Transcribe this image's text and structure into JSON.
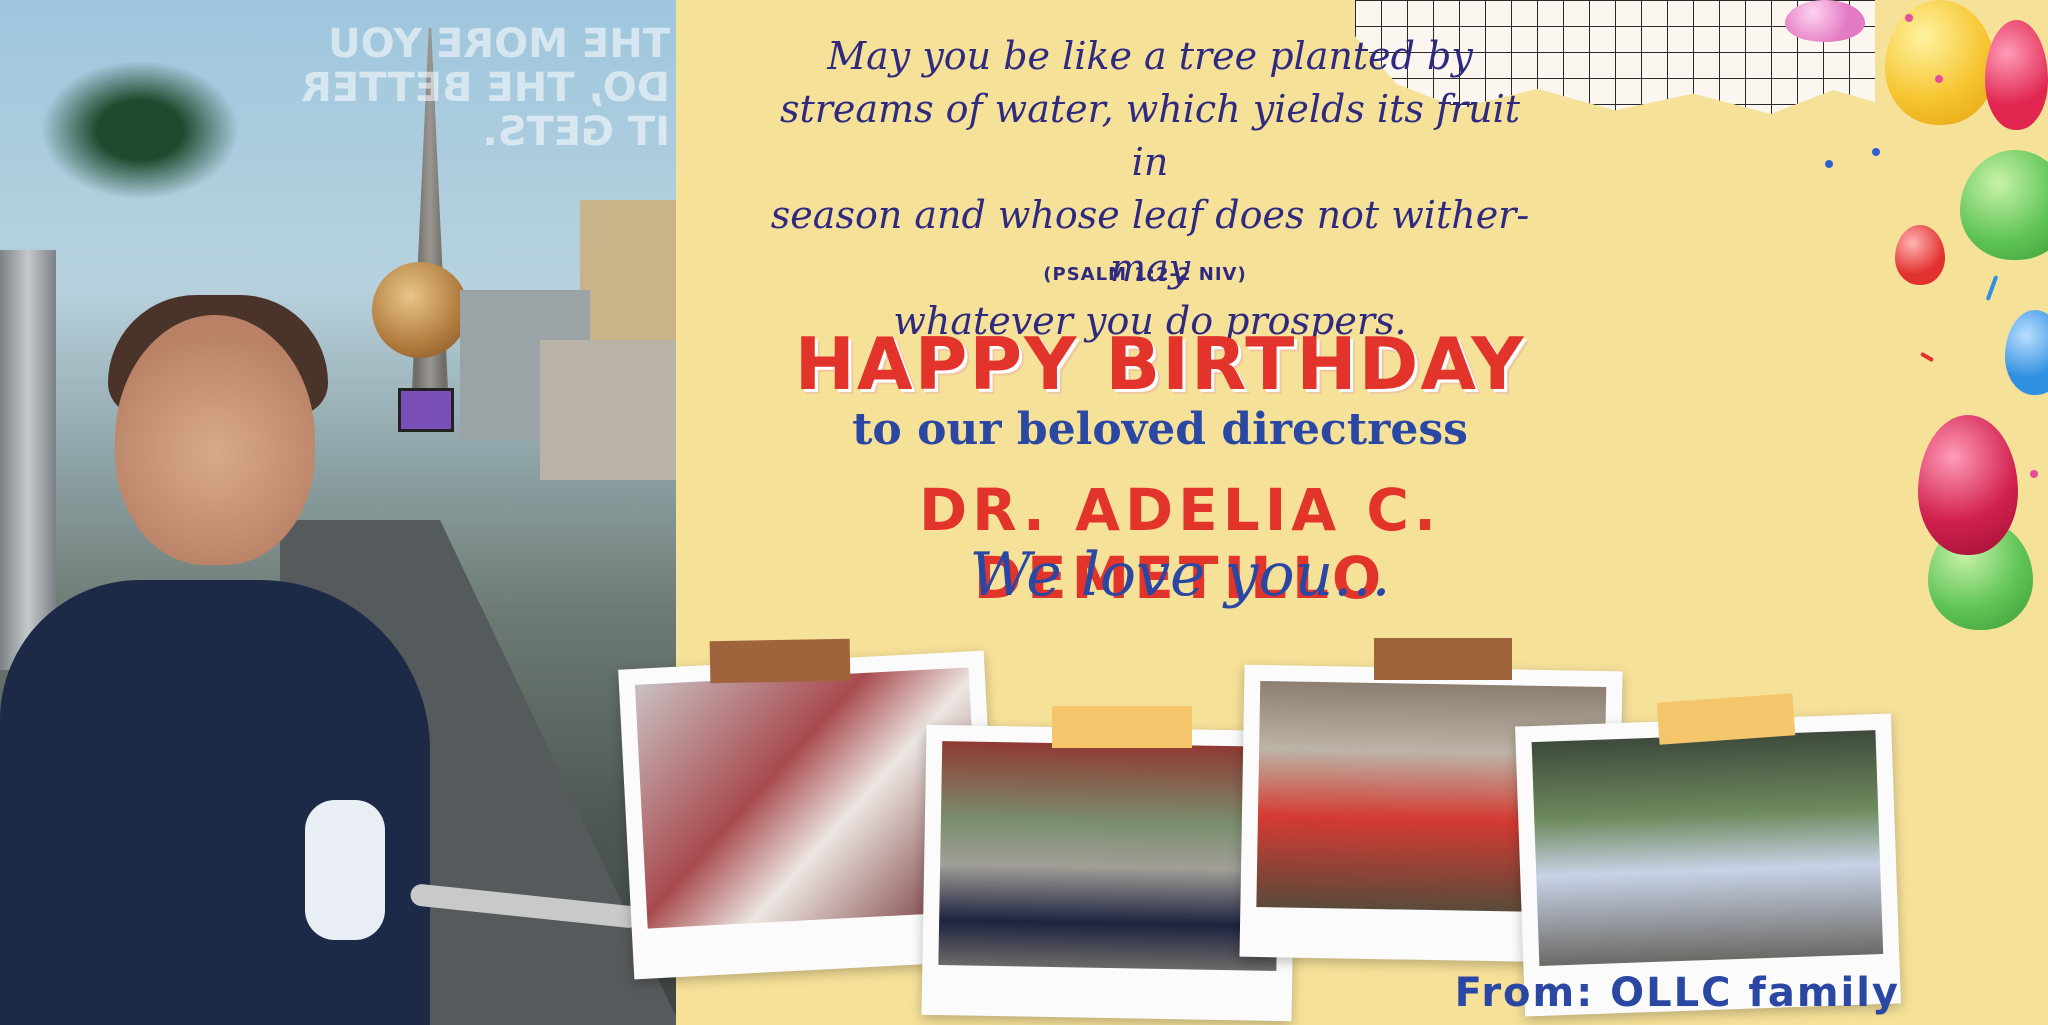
{
  "left_photo": {
    "reflection_text": "THE MORE YOU DO, THE BETTER IT GETS."
  },
  "verse": {
    "line1": "May you be like a tree planted by",
    "line2": "streams of water, which yields its fruit in",
    "line3": "season and whose leaf does not wither-may",
    "line4": "whatever you do prospers.",
    "citation": "(PSALM 1:2-2 NIV)"
  },
  "greeting": {
    "headline": "HAPPY BIRTHDAY",
    "subtitle": "to our beloved directress",
    "name": "DR. ADELIA C. DEMETILLO",
    "closing": "We love you..."
  },
  "footer": {
    "from_label": "From:",
    "from_value": "OLLC family"
  },
  "colors": {
    "background": "#f6e199",
    "accent_red": "#e3342c",
    "accent_blue": "#2a48a3",
    "verse_purple": "#2f2a80"
  },
  "icons": [
    "balloon-icon",
    "confetti-icon",
    "grid-paper-icon",
    "tape-icon"
  ]
}
